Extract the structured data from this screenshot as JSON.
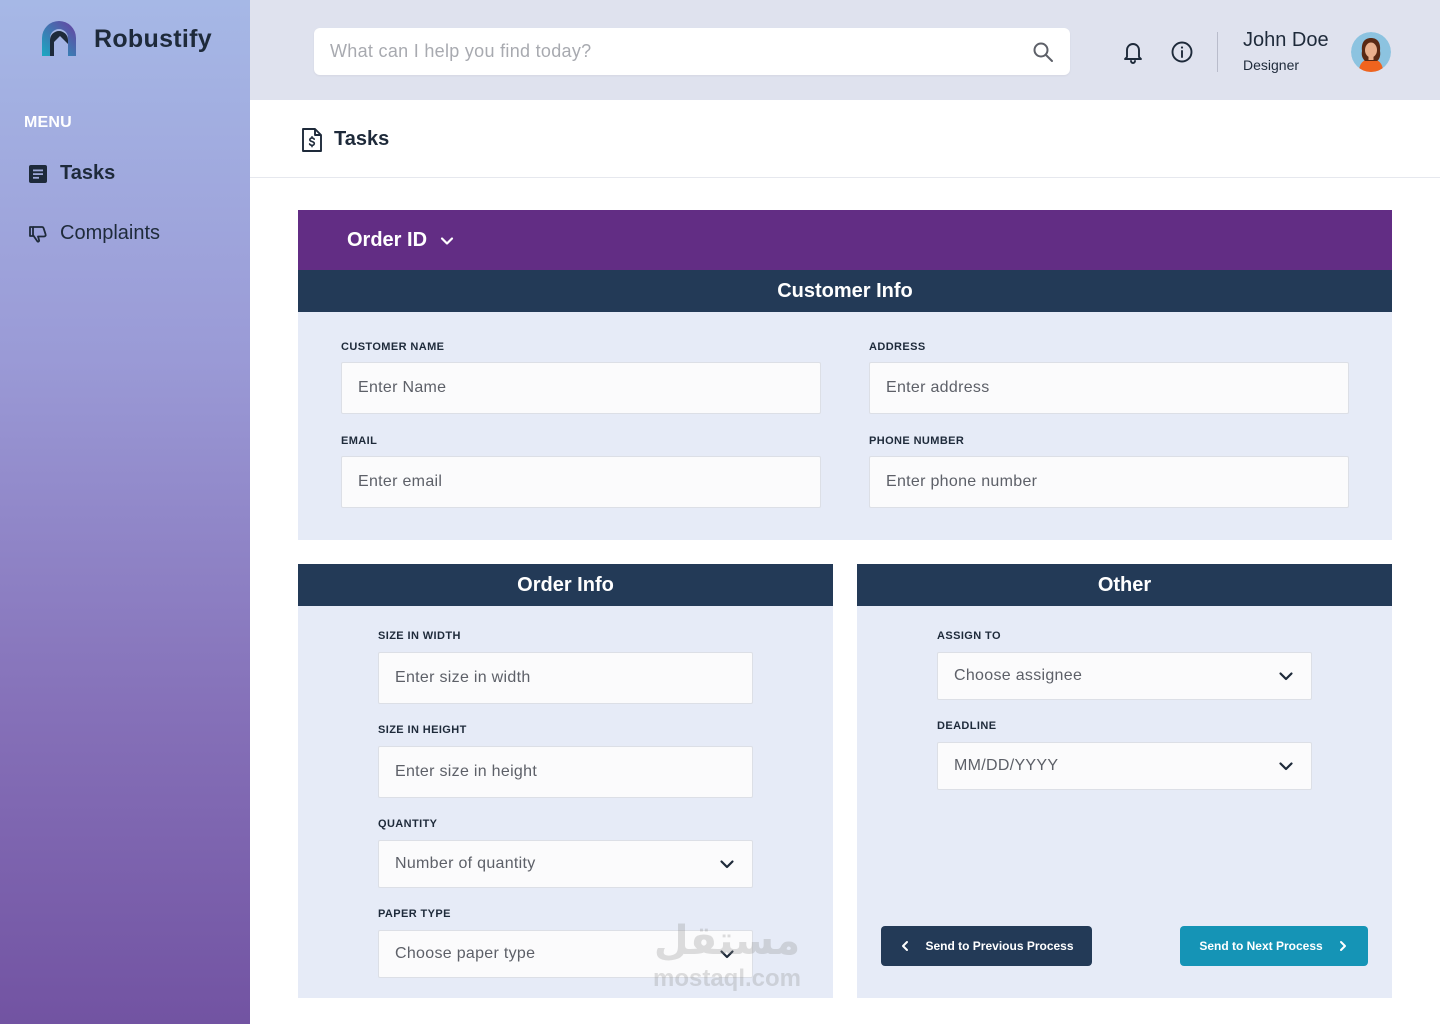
{
  "brand": {
    "name": "Robustify"
  },
  "sidebar": {
    "menu_label": "MENU",
    "items": [
      {
        "label": "Tasks",
        "icon": "document-list-icon",
        "active": true
      },
      {
        "label": "Complaints",
        "icon": "thumbs-down-icon",
        "active": false
      }
    ]
  },
  "topbar": {
    "search": {
      "placeholder": "What can I help you find today?"
    },
    "user": {
      "name": "John Doe",
      "role": "Designer"
    }
  },
  "page": {
    "title": "Tasks"
  },
  "order_id": {
    "label": "Order ID"
  },
  "customer_info": {
    "title": "Customer Info",
    "fields": {
      "name": {
        "label": "CUSTOMER NAME",
        "placeholder": "Enter Name"
      },
      "address": {
        "label": "ADDRESS",
        "placeholder": "Enter address"
      },
      "email": {
        "label": "EMAIL",
        "placeholder": "Enter email"
      },
      "phone": {
        "label": "PHONE NUMBER",
        "placeholder": "Enter phone number"
      }
    }
  },
  "order_info": {
    "title": "Order Info",
    "fields": {
      "width": {
        "label": "SIZE IN WIDTH",
        "placeholder": "Enter size in width"
      },
      "height": {
        "label": "SIZE IN HEIGHT",
        "placeholder": "Enter size in height"
      },
      "quantity": {
        "label": "QUANTITY",
        "placeholder": "Number of quantity"
      },
      "paper": {
        "label": "PAPER TYPE",
        "placeholder": "Choose paper type"
      }
    }
  },
  "other": {
    "title": "Other",
    "fields": {
      "assign": {
        "label": "ASSIGN TO",
        "placeholder": "Choose assignee"
      },
      "deadline": {
        "label": "DEADLINE",
        "placeholder": "MM/DD/YYYY"
      }
    },
    "prev_button": "Send to Previous Process",
    "next_button": "Send to Next Process"
  },
  "watermark": {
    "arabic": "مستقل",
    "latin": "mostaql.com"
  },
  "colors": {
    "purple_bar": "#622d84",
    "section_header": "#233a57",
    "section_body": "#e6ebf7",
    "next_button": "#1594b6",
    "topbar": "#dfe2ee"
  }
}
